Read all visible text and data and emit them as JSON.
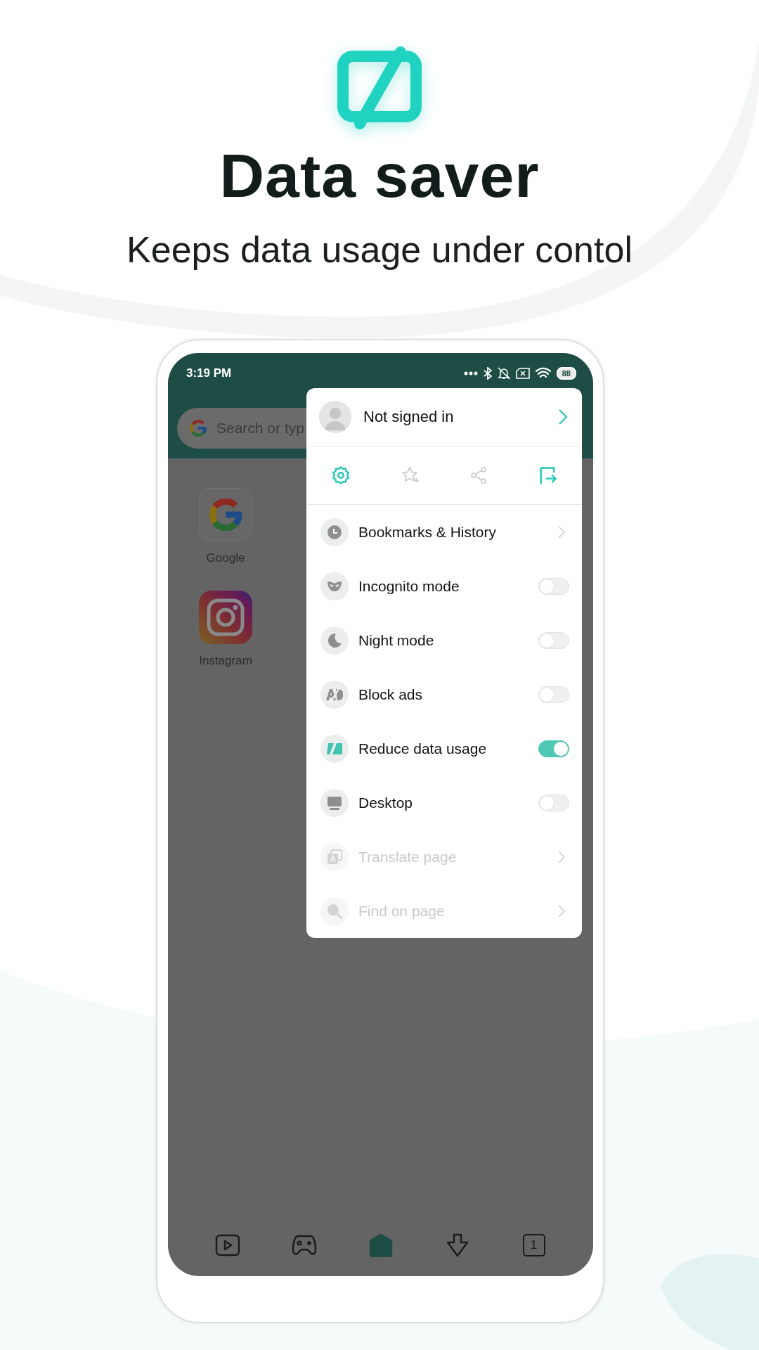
{
  "hero": {
    "title": "Data saver",
    "subtitle": "Keeps data usage under contol"
  },
  "status_bar": {
    "time": "3:19 PM",
    "battery": "88"
  },
  "search": {
    "placeholder": "Search or typ"
  },
  "shortcuts": [
    {
      "label": "Google",
      "kind": "google"
    },
    {
      "label": "Instagram",
      "kind": "instagram"
    }
  ],
  "menu": {
    "account": "Not signed in",
    "quick_actions": [
      {
        "kind": "settings",
        "disabled": false
      },
      {
        "kind": "add-bookmark",
        "disabled": true
      },
      {
        "kind": "share",
        "disabled": true
      },
      {
        "kind": "exit",
        "disabled": false
      }
    ],
    "items": [
      {
        "kind": "link",
        "label": "Bookmarks & History",
        "disabled": false
      },
      {
        "kind": "toggle",
        "label": "Incognito mode",
        "on": false,
        "disabled": false
      },
      {
        "kind": "toggle",
        "label": "Night mode",
        "on": false,
        "disabled": false
      },
      {
        "kind": "toggle",
        "label": "Block ads",
        "on": false,
        "disabled": false
      },
      {
        "kind": "toggle",
        "label": "Reduce data usage",
        "on": true,
        "disabled": false
      },
      {
        "kind": "toggle",
        "label": "Desktop",
        "on": false,
        "disabled": false
      },
      {
        "kind": "link",
        "label": "Translate page",
        "disabled": true
      },
      {
        "kind": "link",
        "label": "Find on page",
        "disabled": true
      }
    ]
  },
  "bottom_nav": [
    {
      "kind": "video",
      "selected": false
    },
    {
      "kind": "games",
      "selected": false
    },
    {
      "kind": "home",
      "selected": true
    },
    {
      "kind": "download",
      "selected": false
    },
    {
      "kind": "tabs",
      "count": "1",
      "selected": false
    }
  ]
}
